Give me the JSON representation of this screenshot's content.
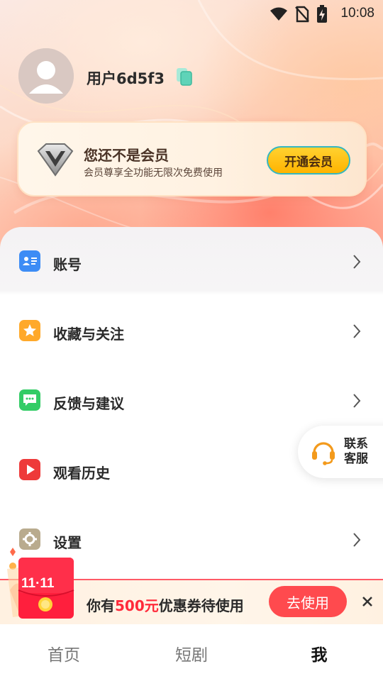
{
  "status_bar": {
    "time": "10:08",
    "icons": [
      "wifi-icon",
      "no-sim-icon",
      "battery-charging-icon"
    ]
  },
  "profile": {
    "username": "用户6d5f3",
    "avatar_icon": "default-avatar-icon",
    "copy_icon": "copy-icon"
  },
  "vip": {
    "title": "您还不是会员",
    "subtitle": "会员尊享全功能无限次免费使用",
    "button_label": "开通会员",
    "icon": "vip-diamond-icon"
  },
  "menu": {
    "items": [
      {
        "label": "账号",
        "icon": "account-card-icon",
        "icon_color": "#3d8cf5",
        "chevron": true
      },
      {
        "label": "收藏与关注",
        "icon": "star-icon",
        "icon_color": "#ffa92a",
        "chevron": true
      },
      {
        "label": "反馈与建议",
        "icon": "chat-bubble-icon",
        "icon_color": "#33cc66",
        "chevron": true
      },
      {
        "label": "观看历史",
        "icon": "play-icon",
        "icon_color": "#ee3a3a",
        "chevron": false
      },
      {
        "label": "设置",
        "icon": "gear-icon",
        "icon_color": "#b9ab8e",
        "chevron": true
      }
    ]
  },
  "customer_service": {
    "label_line1": "联系",
    "label_line2": "客服",
    "icon": "headset-icon"
  },
  "promo": {
    "badge_text": "11·11",
    "text_before": "你有",
    "highlight": "500元",
    "text_after": "优惠券待使用",
    "button_label": "去使用",
    "close_icon": "close-icon",
    "highlight_color": "#ff2a3a"
  },
  "bottom_nav": {
    "tabs": [
      {
        "label": "首页",
        "active": false
      },
      {
        "label": "短剧",
        "active": false
      },
      {
        "label": "我",
        "active": true
      }
    ]
  }
}
